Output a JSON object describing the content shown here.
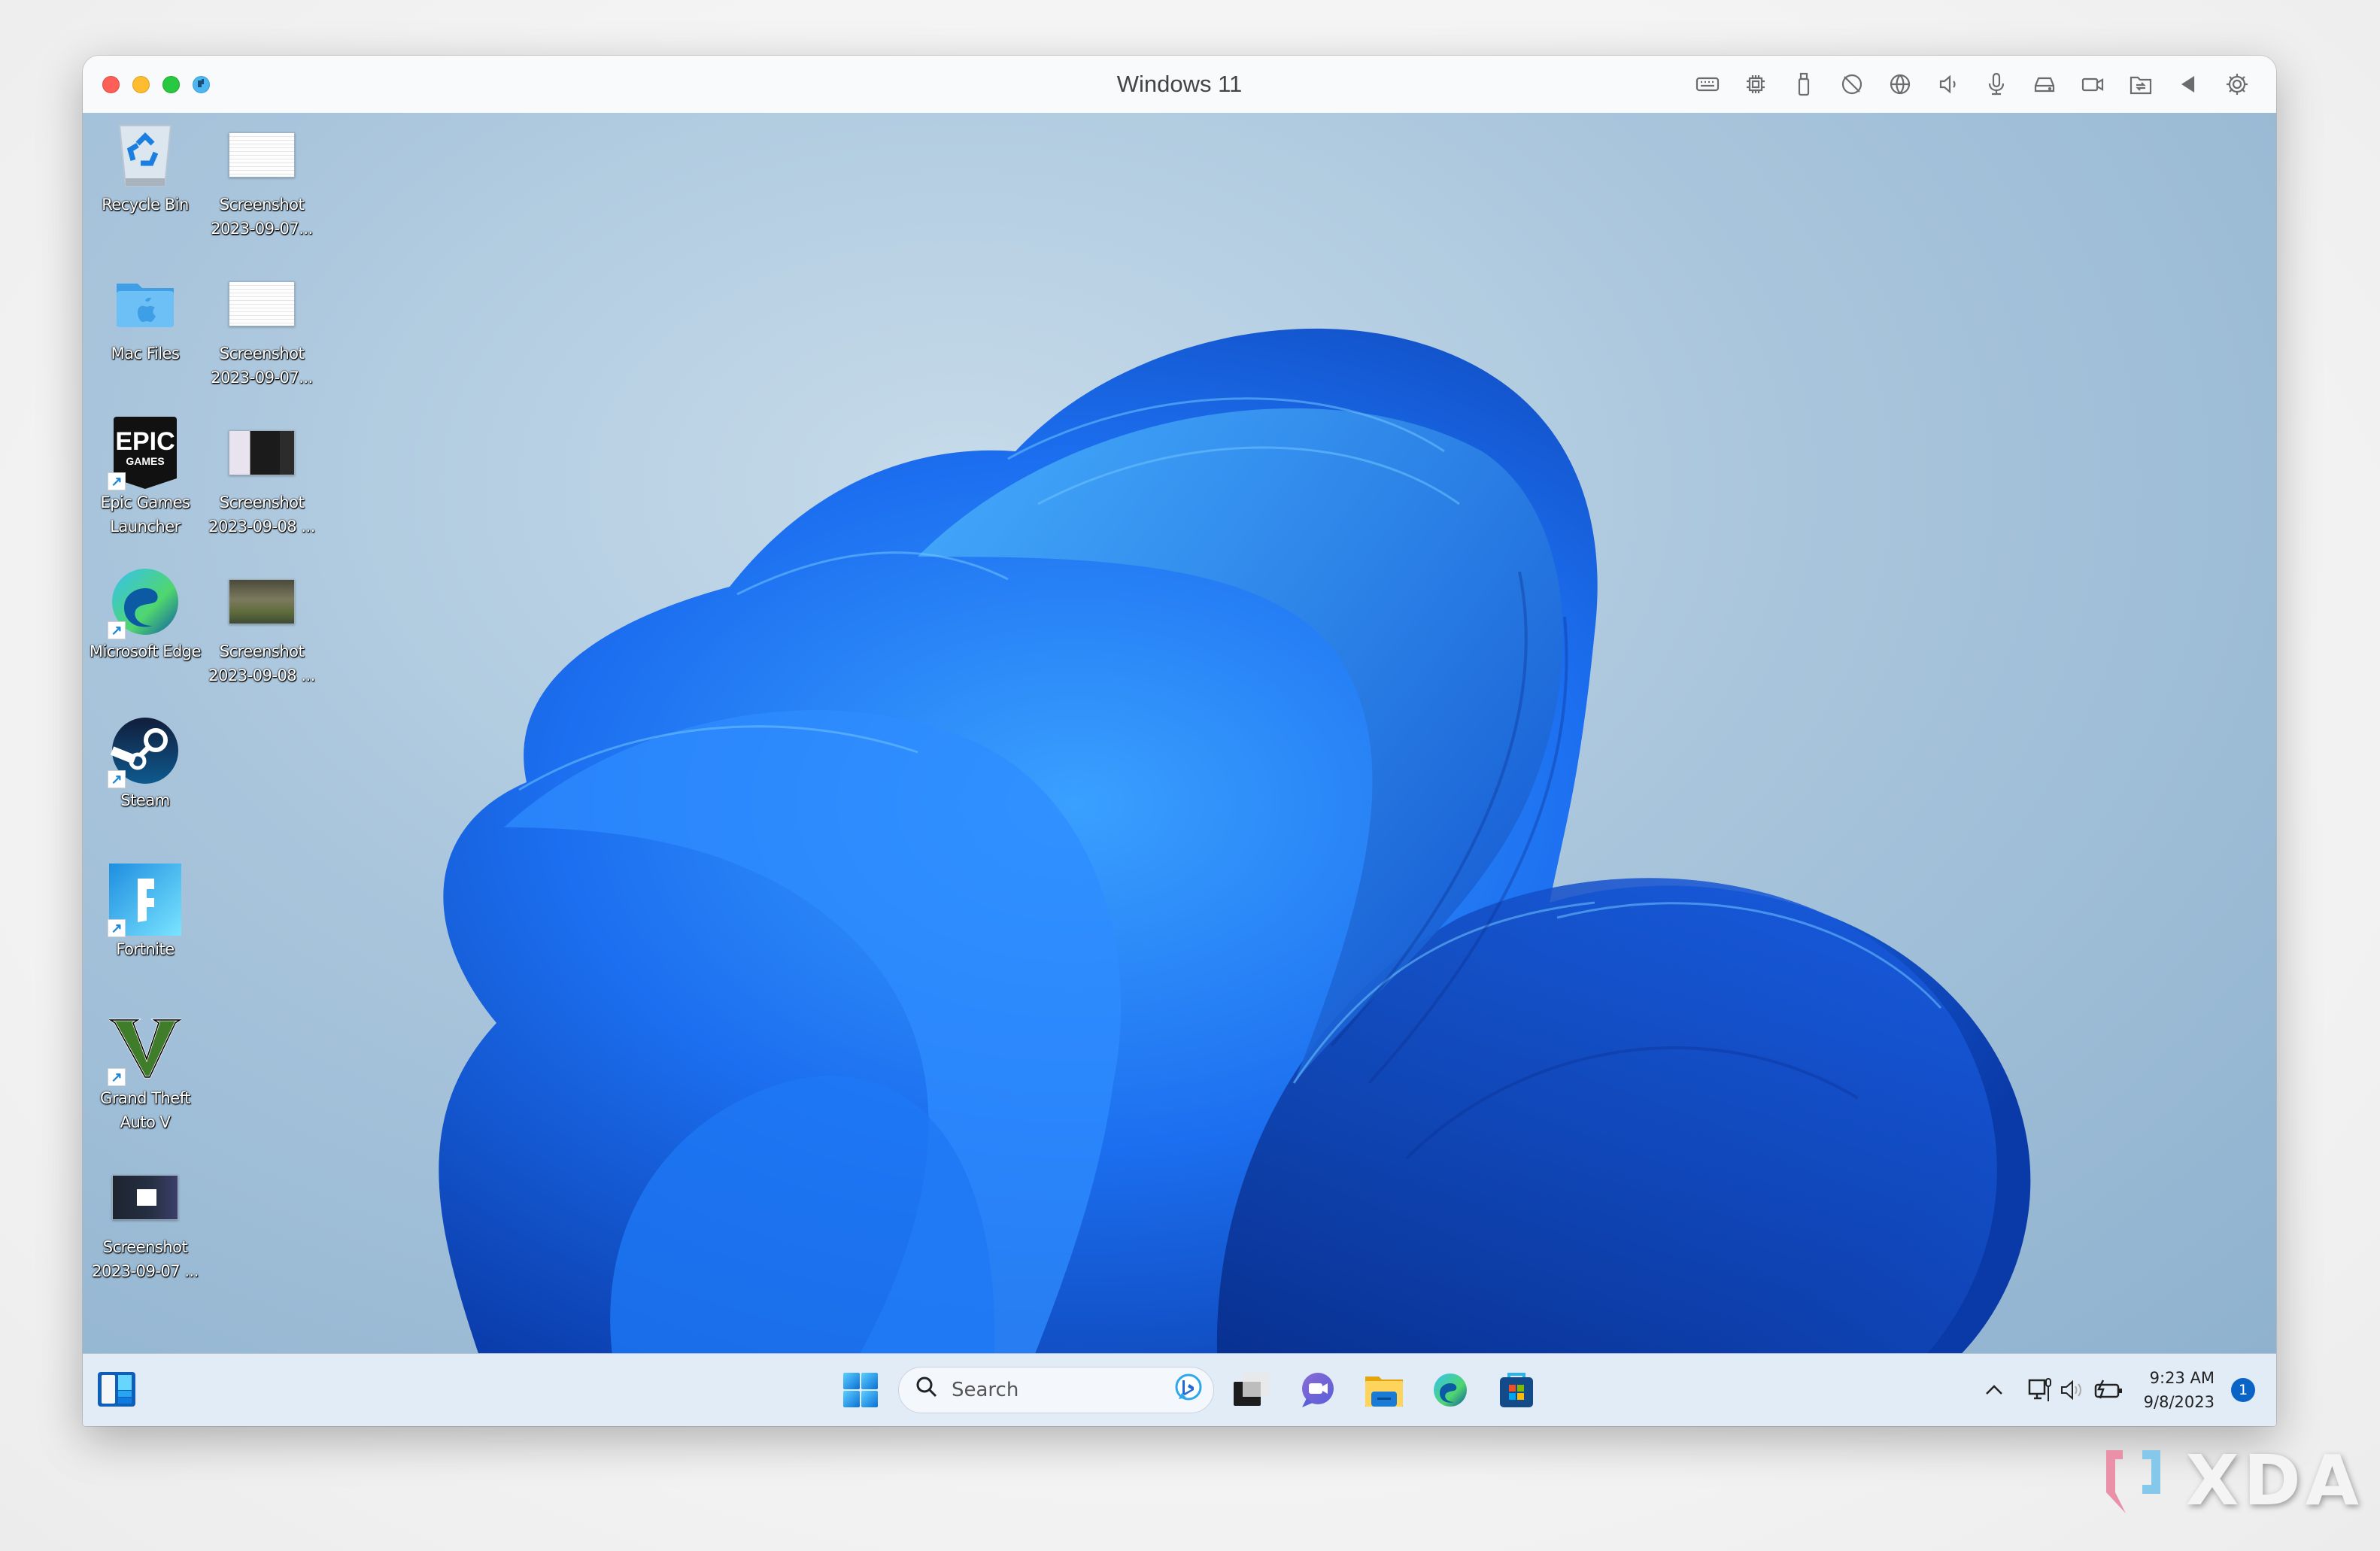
{
  "window": {
    "title": "Windows 11",
    "traffic_lights": [
      {
        "name": "close",
        "color": "#fe5f57"
      },
      {
        "name": "minimize",
        "color": "#febc2e"
      },
      {
        "name": "maximize",
        "color": "#28c840"
      },
      {
        "name": "coherence",
        "color": "#4cb6f0"
      }
    ],
    "toolbar_icons": [
      "keyboard-icon",
      "cpu-icon",
      "usb-icon",
      "camera-off-icon",
      "globe-icon",
      "speaker-icon",
      "microphone-icon",
      "drive-icon",
      "video-camera-icon",
      "shared-folder-icon",
      "back-arrow-icon",
      "gear-icon"
    ]
  },
  "desktop": {
    "icons": [
      {
        "label": "Recycle Bin",
        "icon": "recycle-bin-icon",
        "shortcut": false
      },
      {
        "label": "Screenshot 2023-09-07...",
        "icon": "screenshot-thumbnail",
        "shortcut": false
      },
      {
        "label": "Mac Files",
        "icon": "mac-folder-icon",
        "shortcut": false
      },
      {
        "label": "Screenshot 2023-09-07...",
        "icon": "screenshot-thumbnail",
        "shortcut": false
      },
      {
        "label": "Epic Games Launcher",
        "icon": "epic-games-icon",
        "shortcut": true
      },
      {
        "label": "Screenshot 2023-09-08 ...",
        "icon": "screenshot-thumbnail",
        "shortcut": false
      },
      {
        "label": "Microsoft Edge",
        "icon": "edge-icon",
        "shortcut": true
      },
      {
        "label": "Screenshot 2023-09-08 ...",
        "icon": "screenshot-thumbnail",
        "shortcut": false
      },
      {
        "label": "Steam",
        "icon": "steam-icon",
        "shortcut": true
      },
      {
        "label": "Fortnite",
        "icon": "fortnite-icon",
        "shortcut": true
      },
      {
        "label": "Grand Theft Auto V",
        "icon": "gta-v-icon",
        "shortcut": true
      },
      {
        "label": "Screenshot 2023-09-07 ...",
        "icon": "screenshot-thumbnail",
        "shortcut": false
      }
    ],
    "wallpaper": "Windows 11 Bloom (blue)",
    "accent_color": "#1e6ff0"
  },
  "taskbar": {
    "widgets_icon": "widgets-icon",
    "start_icon": "windows-start-icon",
    "search": {
      "placeholder": "Search",
      "bing_icon": "bing-chat-icon"
    },
    "apps": [
      {
        "name": "Task View",
        "icon": "task-view-icon"
      },
      {
        "name": "Teams Chat",
        "icon": "teams-chat-icon"
      },
      {
        "name": "File Explorer",
        "icon": "file-explorer-icon"
      },
      {
        "name": "Microsoft Edge",
        "icon": "edge-icon"
      },
      {
        "name": "Microsoft Store",
        "icon": "store-icon"
      }
    ],
    "tray": {
      "overflow_icon": "chevron-up-icon",
      "network_icon": "network-icon",
      "volume_icon": "volume-icon",
      "battery_icon": "battery-charging-icon",
      "time": "9:23 AM",
      "date": "9/8/2023",
      "notification_count": "1"
    }
  },
  "watermark": {
    "text": "XDA"
  }
}
